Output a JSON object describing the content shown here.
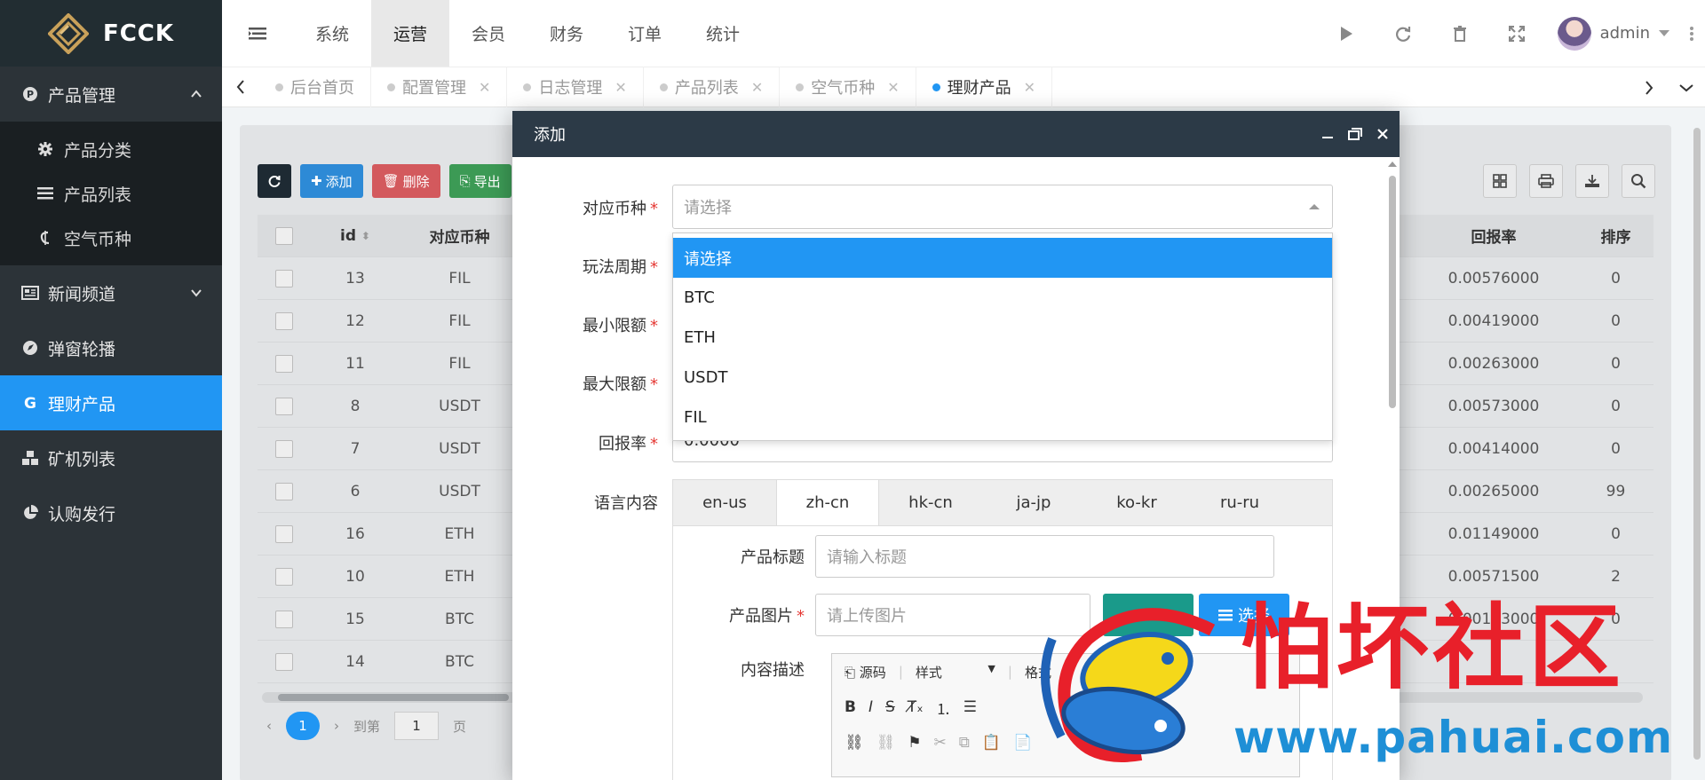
{
  "brand": {
    "name": "FCCK"
  },
  "sidebar": {
    "sections": [
      {
        "label": "产品管理",
        "icon": "product-icon",
        "expanded": true,
        "children": [
          {
            "label": "产品分类",
            "icon": "gear-icon"
          },
          {
            "label": "产品列表",
            "icon": "list-icon"
          },
          {
            "label": "空气币种",
            "icon": "coin-icon"
          }
        ]
      },
      {
        "label": "新闻频道",
        "icon": "news-icon"
      },
      {
        "label": "弹窗轮播",
        "icon": "carousel-icon"
      },
      {
        "label": "理财产品",
        "icon": "finance-icon",
        "active": true
      },
      {
        "label": "矿机列表",
        "icon": "cubes-icon"
      },
      {
        "label": "认购发行",
        "icon": "pie-icon"
      }
    ]
  },
  "topnav": {
    "items": [
      "系统",
      "运营",
      "会员",
      "财务",
      "订单",
      "统计"
    ],
    "active": "运营",
    "user": "admin"
  },
  "tabs": [
    {
      "label": "后台首页",
      "closable": false
    },
    {
      "label": "配置管理",
      "closable": true
    },
    {
      "label": "日志管理",
      "closable": true
    },
    {
      "label": "产品列表",
      "closable": true
    },
    {
      "label": "空气币种",
      "closable": true
    },
    {
      "label": "理财产品",
      "closable": true,
      "active": true
    }
  ],
  "toolbar": {
    "add": "添加",
    "delete": "删除",
    "export": "导出"
  },
  "table": {
    "headers": {
      "id": "id",
      "coin": "对应币种",
      "rate": "回报率",
      "sort": "排序"
    },
    "rows": [
      {
        "id": "13",
        "coin": "FIL",
        "rate": "0.00576000",
        "sort": "0"
      },
      {
        "id": "12",
        "coin": "FIL",
        "rate": "0.00419000",
        "sort": "0"
      },
      {
        "id": "11",
        "coin": "FIL",
        "rate": "0.00263000",
        "sort": "0"
      },
      {
        "id": "8",
        "coin": "USDT",
        "rate": "0.00573000",
        "sort": "0"
      },
      {
        "id": "7",
        "coin": "USDT",
        "rate": "0.00414000",
        "sort": "0"
      },
      {
        "id": "6",
        "coin": "USDT",
        "rate": "0.00265000",
        "sort": "99"
      },
      {
        "id": "16",
        "coin": "ETH",
        "rate": "0.01149000",
        "sort": "0"
      },
      {
        "id": "10",
        "coin": "ETH",
        "rate": "0.00571500",
        "sort": "2"
      },
      {
        "id": "15",
        "coin": "BTC",
        "rate": "0.00153000",
        "sort": "0"
      },
      {
        "id": "14",
        "coin": "BTC",
        "rate": "",
        "sort": ""
      }
    ]
  },
  "pager": {
    "current": "1",
    "goto": "到第",
    "page_input": "1",
    "page": "页"
  },
  "modal": {
    "title": "添加",
    "fields": {
      "coin": {
        "label": "对应币种",
        "placeholder": "请选择"
      },
      "period": {
        "label": "玩法周期"
      },
      "min": {
        "label": "最小限额"
      },
      "max": {
        "label": "最大限额"
      },
      "rate": {
        "label": "回报率",
        "value": "0.0000"
      },
      "lang": {
        "label": "语言内容"
      }
    },
    "dropdown_options": [
      "请选择",
      "BTC",
      "ETH",
      "USDT",
      "FIL"
    ],
    "selected_option": "请选择",
    "lang_tabs": [
      "en-us",
      "zh-cn",
      "hk-cn",
      "ja-jp",
      "ko-kr",
      "ru-ru"
    ],
    "active_lang": "zh-cn",
    "product_title": {
      "label": "产品标题",
      "placeholder": "请输入标题"
    },
    "product_image": {
      "label": "产品图片",
      "placeholder": "请上传图片",
      "choose": "选择"
    },
    "content_desc": {
      "label": "内容描述"
    },
    "editor": {
      "source": "源码",
      "style": "样式",
      "format": "格式"
    }
  },
  "watermark": {
    "title": "怕坏社区",
    "url": "www.pahuai.com"
  }
}
